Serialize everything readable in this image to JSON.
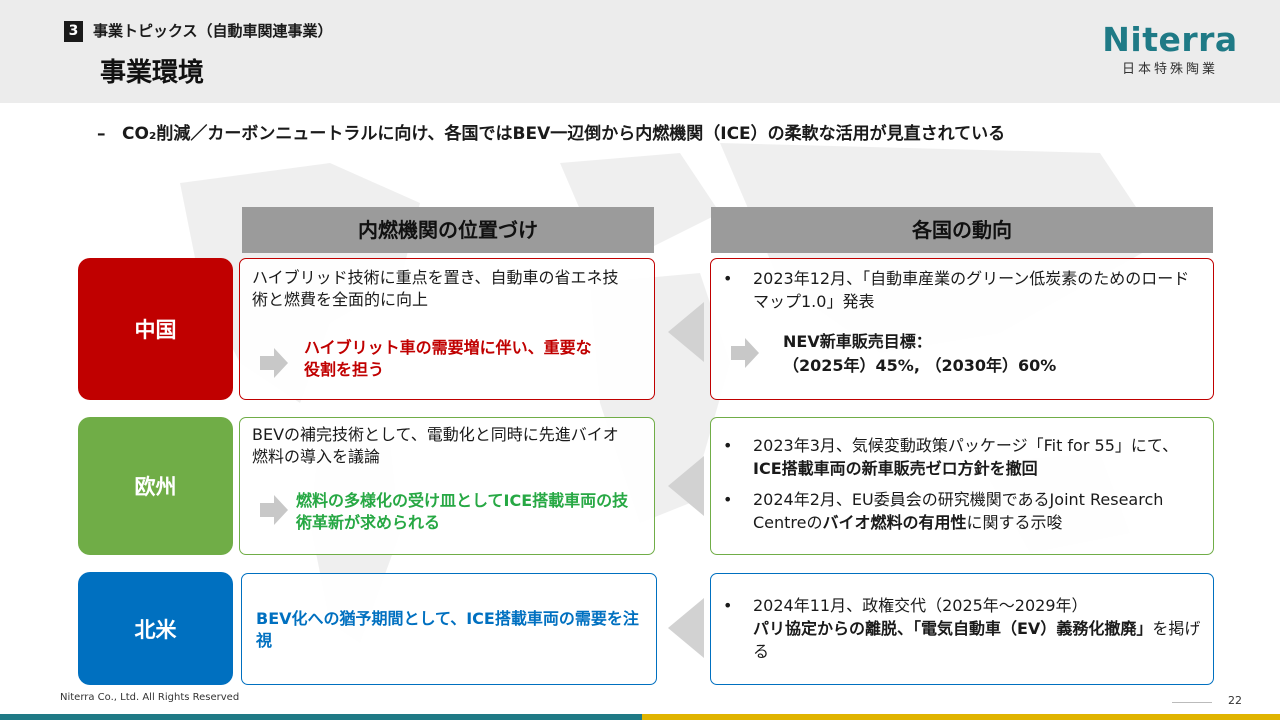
{
  "header": {
    "section_number": "3",
    "section_label": "事業トピックス（自動車関連事業）",
    "title": "事業環境",
    "logo_name": "Niterra",
    "logo_sub": "日本特殊陶業"
  },
  "lead": {
    "dash": "–",
    "text": "CO₂削減／カーボンニュートラルに向け、各国ではBEV一辺倒から内燃機関（ICE）の柔軟な活用が見直されている"
  },
  "columns": {
    "left": "内燃機関の位置づけ",
    "right": "各国の動向"
  },
  "rows": {
    "china": {
      "region": "中国",
      "position_text": "ハイブリッド技術に重点を置き、自動車の省エネ技術と燃費を全面的に向上",
      "position_emph": "ハイブリット車の需要増に伴い、重要な役割を担う",
      "trend_bullet": "•",
      "trend_text": "2023年12月、「自動車産業のグリーン低炭素のためのロードマップ1.0」発表",
      "trend_target_label": "NEV新車販売目標：",
      "trend_target_values": "（2025年）45%, （2030年）60%"
    },
    "europe": {
      "region": "欧州",
      "position_text": "BEVの補完技術として、電動化と同時に先進バイオ燃料の導入を議論",
      "position_emph": "燃料の多様化の受け皿としてICE搭載車両の技術革新が求められる",
      "trend_bullet": "•",
      "trend1_pre": "2023年3月、気候変動政策パッケージ「Fit for 55」にて、",
      "trend1_bold": "ICE搭載車両の新車販売ゼロ方針を撤回",
      "trend2_pre": "2024年2月、EU委員会の研究機関であるJoint Research Centreの",
      "trend2_bold": "バイオ燃料の有用性",
      "trend2_post": "に関する示唆"
    },
    "north_america": {
      "region": "北米",
      "position_emph": "BEV化への猶予期間として、ICE搭載車両の需要を注視",
      "trend_bullet": "•",
      "trend_pre": "2024年11月、政権交代（2025年～2029年）",
      "trend_bold": "パリ協定からの離脱、「電気自動車（EV）義務化撤廃」",
      "trend_post": "を掲げる"
    }
  },
  "footer": {
    "copyright": "Niterra Co., Ltd. All Rights Reserved",
    "page_number": "22"
  },
  "colors": {
    "china": "#c00000",
    "europe": "#70ad47",
    "north_america": "#0070c0",
    "logo": "#1f7a86",
    "accent_bar": "#e0b400"
  },
  "icons": {
    "chevron": "chevron-right-icon",
    "flow": "flow-left-arrow-icon"
  }
}
